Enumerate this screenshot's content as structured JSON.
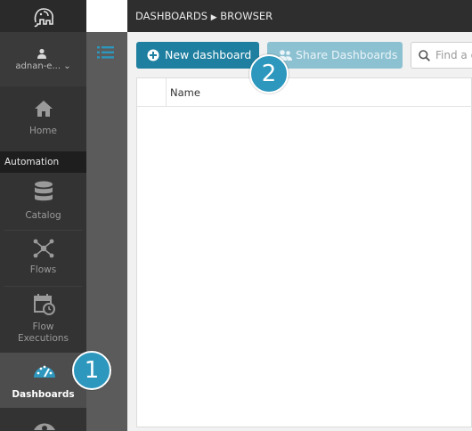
{
  "breadcrumb": {
    "section": "DASHBOARDS",
    "separator": "▶",
    "page": "BROWSER"
  },
  "user": {
    "name": "adnan-e...",
    "chevron": "⌄"
  },
  "nav": {
    "home": "Home",
    "section_label": "Automation",
    "catalog": "Catalog",
    "flows": "Flows",
    "flow_executions_1": "Flow",
    "flow_executions_2": "Executions",
    "dashboards": "Dashboards"
  },
  "toolbar": {
    "new_dashboard": "New dashboard",
    "share_dashboards": "Share Dashboards",
    "search_placeholder": "Find a d"
  },
  "table": {
    "columns": [
      "Name"
    ]
  },
  "callouts": [
    "1",
    "2"
  ],
  "colors": {
    "accent": "#1e7fa0",
    "callout": "#2d97bd",
    "sidebar": "#333333"
  },
  "icons": [
    "elephant-logo-icon",
    "user-icon",
    "list-icon",
    "home-icon",
    "database-icon",
    "flows-icon",
    "calendar-clock-icon",
    "gauge-icon",
    "plus-circle-icon",
    "share-icon",
    "search-icon"
  ]
}
